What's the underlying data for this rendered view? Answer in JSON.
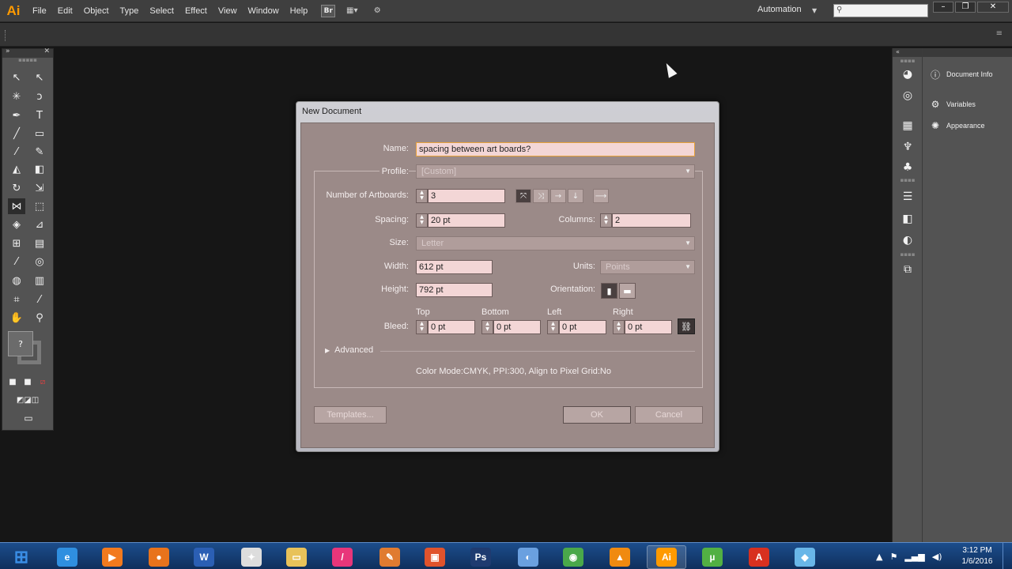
{
  "app": {
    "logo": "Ai",
    "menus": [
      "File",
      "Edit",
      "Object",
      "Type",
      "Select",
      "Effect",
      "View",
      "Window",
      "Help"
    ],
    "bridge_label": "Br",
    "workspace": "Automation",
    "search_placeholder": ""
  },
  "right_dock": {
    "panels": [
      {
        "label": "Document Info",
        "icon": "info-icon"
      },
      {
        "label": "Variables",
        "icon": "variables-icon"
      },
      {
        "label": "Appearance",
        "icon": "appearance-icon"
      }
    ]
  },
  "dialog": {
    "title": "New Document",
    "name_label": "Name:",
    "name_value": "spacing between art boards?",
    "profile_label": "Profile:",
    "profile_value": "[Custom]",
    "artboards_label": "Number of Artboards:",
    "artboards_value": "3",
    "spacing_label": "Spacing:",
    "spacing_value": "20 pt",
    "columns_label": "Columns:",
    "columns_value": "2",
    "size_label": "Size:",
    "size_value": "Letter",
    "width_label": "Width:",
    "width_value": "612 pt",
    "units_label": "Units:",
    "units_value": "Points",
    "height_label": "Height:",
    "height_value": "792 pt",
    "orientation_label": "Orientation:",
    "bleed_label": "Bleed:",
    "bleed": {
      "top_label": "Top",
      "top_value": "0 pt",
      "bottom_label": "Bottom",
      "bottom_value": "0 pt",
      "left_label": "Left",
      "left_value": "0 pt",
      "right_label": "Right",
      "right_value": "0 pt"
    },
    "advanced_label": "Advanced",
    "summary": "Color Mode:CMYK, PPI:300, Align to Pixel Grid:No",
    "templates_button": "Templates...",
    "ok_button": "OK",
    "cancel_button": "Cancel"
  },
  "taskbar": {
    "apps": [
      {
        "name": "start",
        "glyph": "⊞",
        "color": "#3a8ee6"
      },
      {
        "name": "internet-explorer",
        "glyph": "e",
        "color": "#2f8fe0"
      },
      {
        "name": "media-player",
        "glyph": "▶",
        "color": "#f27a1e"
      },
      {
        "name": "firefox",
        "glyph": "●",
        "color": "#e8731c"
      },
      {
        "name": "word",
        "glyph": "W",
        "color": "#2b5fb4"
      },
      {
        "name": "camtasia",
        "glyph": "✦",
        "color": "#dddddd"
      },
      {
        "name": "file-explorer",
        "glyph": "▭",
        "color": "#e8c25a"
      },
      {
        "name": "app-pink",
        "glyph": "/",
        "color": "#e8367a"
      },
      {
        "name": "app-tools",
        "glyph": "✎",
        "color": "#e07b30"
      },
      {
        "name": "app-red",
        "glyph": "▣",
        "color": "#e0532c"
      },
      {
        "name": "photoshop",
        "glyph": "Ps",
        "color": "#1f3b70"
      },
      {
        "name": "app-paint",
        "glyph": "◐",
        "color": "#6aa0e0"
      },
      {
        "name": "chrome",
        "glyph": "◉",
        "color": "#4aa84a"
      },
      {
        "name": "vlc",
        "glyph": "▲",
        "color": "#f08a10"
      },
      {
        "name": "illustrator",
        "glyph": "Ai",
        "color": "#ff9a00"
      },
      {
        "name": "utorrent",
        "glyph": "µ",
        "color": "#52b043"
      },
      {
        "name": "acrobat",
        "glyph": "A",
        "color": "#d8301f"
      },
      {
        "name": "app-blue",
        "glyph": "◆",
        "color": "#69b6e8"
      }
    ],
    "time": "3:12 PM",
    "date": "1/6/2016"
  }
}
